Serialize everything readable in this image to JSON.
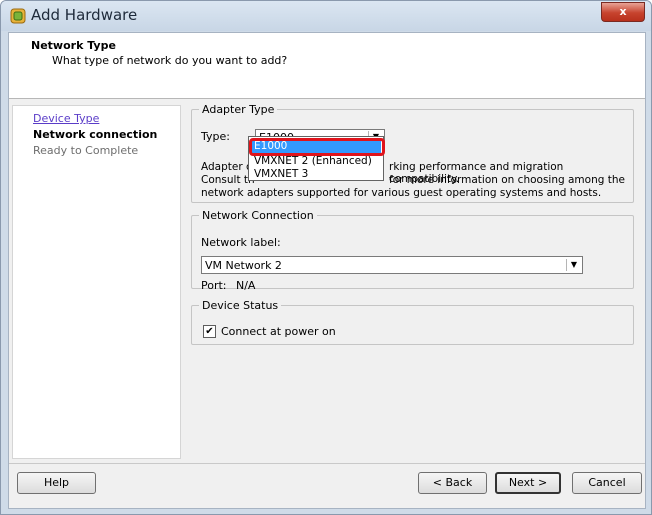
{
  "window": {
    "title": "Add Hardware",
    "close_label": "x"
  },
  "header": {
    "title": "Network Type",
    "subtitle": "What type of network do you want to add?"
  },
  "nav": {
    "items": [
      {
        "label": "Device Type",
        "state": "link"
      },
      {
        "label": "Network connection",
        "state": "active"
      },
      {
        "label": "Ready to Complete",
        "state": "disabled"
      }
    ]
  },
  "adapter": {
    "legend": "Adapter Type",
    "type_label": "Type:",
    "selected": "E1000",
    "description_line1": "Adapter ch",
    "description_line1_end": "rking performance and migration compatibility.",
    "description_line2": "Consult th",
    "description_line2_end": "for more information on choosing among the",
    "description_line3": "network adapters supported for various guest operating systems and hosts.",
    "options": [
      "E1000",
      "VMXNET 2 (Enhanced)",
      "VMXNET 3"
    ],
    "highlight_color": "#e0141c"
  },
  "network_connection": {
    "legend": "Network Connection",
    "network_label": "Network label:",
    "selected": "VM Network 2",
    "port_label": "Port:",
    "port_value": "N/A"
  },
  "device_status": {
    "legend": "Device Status",
    "connect_label": "Connect at power on",
    "connect_checked": true,
    "check_glyph": "✔"
  },
  "footer": {
    "help": "Help",
    "back": "< Back",
    "next": "Next >",
    "cancel": "Cancel"
  },
  "colors": {
    "selection": "#3399ff",
    "link": "#5a3cc8"
  }
}
